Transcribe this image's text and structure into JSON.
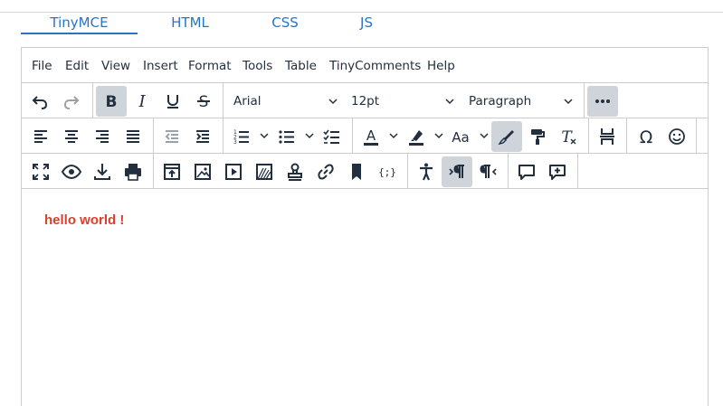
{
  "tabs": [
    {
      "label": "TinyMCE",
      "active": true
    },
    {
      "label": "HTML",
      "active": false
    },
    {
      "label": "CSS",
      "active": false
    },
    {
      "label": "JS",
      "active": false
    }
  ],
  "menubar": [
    "File",
    "Edit",
    "View",
    "Insert",
    "Format",
    "Tools",
    "Table",
    "TinyComments",
    "Help"
  ],
  "toolbar": {
    "font_family": "Arial",
    "font_size": "12pt",
    "block_format": "Paragraph",
    "active_buttons": [
      "bold",
      "more",
      "highlight-format",
      "show-invisibles"
    ],
    "icons": {
      "row1": [
        "undo-icon",
        "redo-icon",
        "bold-icon",
        "italic-icon",
        "underline-icon",
        "strikethrough-icon",
        "more-icon"
      ],
      "row2": [
        "align-left-icon",
        "align-center-icon",
        "align-right-icon",
        "justify-icon",
        "outdent-icon",
        "indent-icon",
        "numbered-list-icon",
        "bullet-list-icon",
        "checklist-icon",
        "text-color-icon",
        "highlight-icon",
        "letter-case-icon",
        "highlighter-icon",
        "format-painter-icon",
        "clear-formatting-icon",
        "page-break-icon",
        "special-character-icon",
        "emoticons-icon"
      ],
      "row3": [
        "fullscreen-icon",
        "preview-icon",
        "export-icon",
        "print-icon",
        "upload-icon",
        "image-icon",
        "media-icon",
        "template-icon",
        "stamp-icon",
        "link-icon",
        "bookmark-icon",
        "code-sample-icon",
        "accessibility-icon",
        "ltr-paragraph-icon",
        "rtl-paragraph-icon",
        "comment-icon",
        "add-comment-icon"
      ]
    }
  },
  "content": {
    "text": "hello world !",
    "text_color": "#e03e2d"
  },
  "colors": {
    "accent": "#2874c9",
    "active_button_bg": "#cfd4db",
    "border": "#cccccc"
  }
}
